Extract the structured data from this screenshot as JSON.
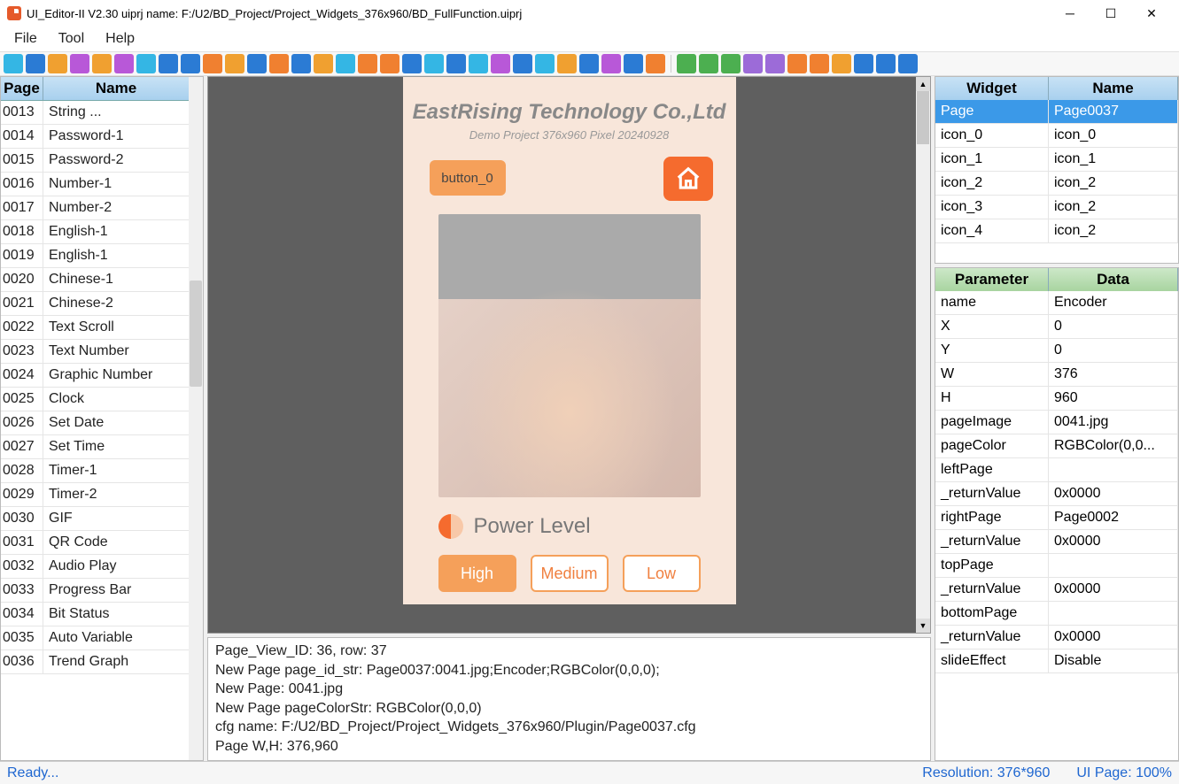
{
  "window": {
    "title": "UI_Editor-II V2.30    uiprj name: F:/U2/BD_Project/Project_Widgets_376x960/BD_FullFunction.uiprj"
  },
  "menu": [
    "File",
    "Tool",
    "Help"
  ],
  "leftTable": {
    "headers": [
      "Page",
      "Name"
    ],
    "rows": [
      {
        "page": "0013",
        "name": "String ..."
      },
      {
        "page": "0014",
        "name": "Password-1"
      },
      {
        "page": "0015",
        "name": "Password-2"
      },
      {
        "page": "0016",
        "name": "Number-1"
      },
      {
        "page": "0017",
        "name": "Number-2"
      },
      {
        "page": "0018",
        "name": "English-1"
      },
      {
        "page": "0019",
        "name": "English-1"
      },
      {
        "page": "0020",
        "name": "Chinese-1"
      },
      {
        "page": "0021",
        "name": "Chinese-2"
      },
      {
        "page": "0022",
        "name": "Text Scroll"
      },
      {
        "page": "0023",
        "name": "Text Number"
      },
      {
        "page": "0024",
        "name": "Graphic Number"
      },
      {
        "page": "0025",
        "name": " Clock"
      },
      {
        "page": "0026",
        "name": "Set Date"
      },
      {
        "page": "0027",
        "name": "Set Time"
      },
      {
        "page": "0028",
        "name": "Timer-1"
      },
      {
        "page": "0029",
        "name": "Timer-2"
      },
      {
        "page": "0030",
        "name": "GIF"
      },
      {
        "page": "0031",
        "name": "QR Code"
      },
      {
        "page": "0032",
        "name": "Audio Play"
      },
      {
        "page": "0033",
        "name": "Progress Bar"
      },
      {
        "page": "0034",
        "name": "Bit Status"
      },
      {
        "page": "0035",
        "name": "Auto Variable"
      },
      {
        "page": "0036",
        "name": "Trend Graph"
      }
    ]
  },
  "canvas": {
    "company": "EastRising Technology Co.,Ltd",
    "subtitle": "Demo Project 376x960 Pixel 20240928",
    "button0": "button_0",
    "powerLabel": "Power Level",
    "levels": [
      "High",
      "Medium",
      "Low"
    ]
  },
  "widgetTable": {
    "headers": [
      "Widget",
      "Name"
    ],
    "rows": [
      {
        "w": "Page",
        "n": "Page0037",
        "sel": true
      },
      {
        "w": "icon_0",
        "n": "icon_0"
      },
      {
        "w": "icon_1",
        "n": "icon_1"
      },
      {
        "w": "icon_2",
        "n": "icon_2"
      },
      {
        "w": "icon_3",
        "n": "icon_2"
      },
      {
        "w": "icon_4",
        "n": "icon_2"
      }
    ]
  },
  "paramTable": {
    "headers": [
      "Parameter",
      "Data"
    ],
    "rows": [
      {
        "p": "name",
        "d": "Encoder"
      },
      {
        "p": "X",
        "d": "0"
      },
      {
        "p": "Y",
        "d": "0"
      },
      {
        "p": "W",
        "d": "376"
      },
      {
        "p": "H",
        "d": "960"
      },
      {
        "p": "pageImage",
        "d": "0041.jpg"
      },
      {
        "p": "pageColor",
        "d": "RGBColor(0,0..."
      },
      {
        "p": "leftPage",
        "d": ""
      },
      {
        "p": "   _returnValue",
        "d": "0x0000"
      },
      {
        "p": "rightPage",
        "d": "Page0002"
      },
      {
        "p": "   _returnValue",
        "d": "0x0000"
      },
      {
        "p": "topPage",
        "d": ""
      },
      {
        "p": "   _returnValue",
        "d": "0x0000"
      },
      {
        "p": "bottomPage",
        "d": ""
      },
      {
        "p": "   _returnValue",
        "d": "0x0000"
      },
      {
        "p": "slideEffect",
        "d": "Disable"
      }
    ]
  },
  "log": [
    "Page_View_ID: 36, row: 37",
    "New Page page_id_str: Page0037:0041.jpg;Encoder;RGBColor(0,0,0);",
    "New Page: 0041.jpg",
    "New Page pageColorStr: RGBColor(0,0,0)",
    "cfg name: F:/U2/BD_Project/Project_Widgets_376x960/Plugin/Page0037.cfg",
    "Page W,H: 376,960"
  ],
  "status": {
    "ready": "Ready...",
    "resolution": "Resolution: 376*960",
    "uipage": "UI Page: 100%"
  },
  "toolbarColors": [
    "#34b6e4",
    "#2b7bd4",
    "#f0a030",
    "#b858d8",
    "#f0a030",
    "#b858d8",
    "#34b6e4",
    "#2b7bd4",
    "#2b7bd4",
    "#f08030",
    "#f0a030",
    "#2b7bd4",
    "#f08030",
    "#2b7bd4",
    "#f0a030",
    "#34b6e4",
    "#f08030",
    "#f08030",
    "#2b7bd4",
    "#34b6e4",
    "#2b7bd4",
    "#34b6e4",
    "#b858d8",
    "#2b7bd4",
    "#34b6e4",
    "#f0a030",
    "#2b7bd4",
    "#b858d8",
    "#2b7bd4",
    "#f08030"
  ],
  "toolbar2": [
    "#4caf50",
    "#4caf50",
    "#4caf50",
    "#9c6bd8",
    "#9c6bd8",
    "#f08030",
    "#f08030",
    "#f0a030",
    "#2b7bd4",
    "#2b7bd4",
    "#2b7bd4"
  ]
}
